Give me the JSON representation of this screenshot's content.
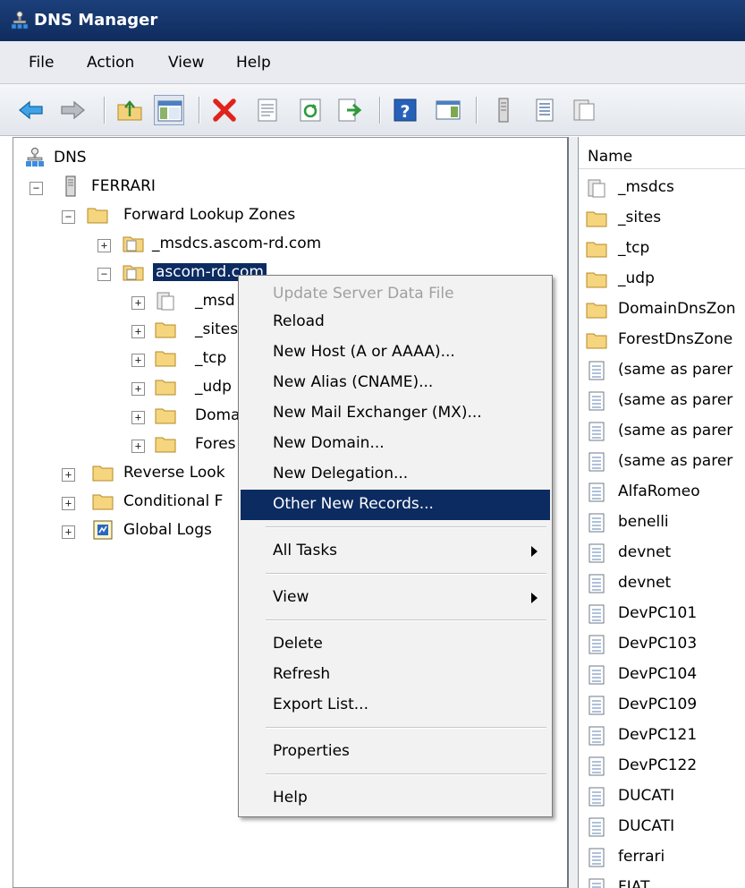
{
  "window": {
    "title": "DNS Manager"
  },
  "menubar": {
    "items": [
      "File",
      "Action",
      "View",
      "Help"
    ]
  },
  "toolbar": {
    "buttons": [
      "back-icon",
      "forward-icon",
      "up-folder-icon",
      "show-hide-tree-icon",
      "delete-icon",
      "properties-icon",
      "refresh-icon",
      "export-list-icon",
      "help-icon",
      "action-pane-icon",
      "server-icon",
      "list-view-icon",
      "zone-icon"
    ]
  },
  "tree": {
    "root": "DNS",
    "server": "FERRARI",
    "forward_zones": "Forward Lookup Zones",
    "zone_msdcs": "_msdcs.ascom-rd.com",
    "zone_selected": "ascom-rd.com",
    "child_msdcs": "_msd",
    "child_sites": "_sites",
    "child_tcp": "_tcp",
    "child_udp": "_udp",
    "child_domain": "Doma",
    "child_forest": "Fores",
    "reverse_zones": "Reverse Look",
    "conditional": "Conditional F",
    "global_logs": "Global Logs"
  },
  "list": {
    "header": "Name",
    "rows": [
      {
        "name": "_msdcs",
        "icon": "zone-icon"
      },
      {
        "name": "_sites",
        "icon": "folder-icon"
      },
      {
        "name": "_tcp",
        "icon": "folder-icon"
      },
      {
        "name": "_udp",
        "icon": "folder-icon"
      },
      {
        "name": "DomainDnsZon",
        "icon": "folder-icon"
      },
      {
        "name": "ForestDnsZone",
        "icon": "folder-icon"
      },
      {
        "name": "(same as parer",
        "icon": "record-icon"
      },
      {
        "name": "(same as parer",
        "icon": "record-icon"
      },
      {
        "name": "(same as parer",
        "icon": "record-icon"
      },
      {
        "name": "(same as parer",
        "icon": "record-icon"
      },
      {
        "name": "AlfaRomeo",
        "icon": "record-icon"
      },
      {
        "name": "benelli",
        "icon": "record-icon"
      },
      {
        "name": "devnet",
        "icon": "record-icon"
      },
      {
        "name": "devnet",
        "icon": "record-icon"
      },
      {
        "name": "DevPC101",
        "icon": "record-icon"
      },
      {
        "name": "DevPC103",
        "icon": "record-icon"
      },
      {
        "name": "DevPC104",
        "icon": "record-icon"
      },
      {
        "name": "DevPC109",
        "icon": "record-icon"
      },
      {
        "name": "DevPC121",
        "icon": "record-icon"
      },
      {
        "name": "DevPC122",
        "icon": "record-icon"
      },
      {
        "name": "DUCATI",
        "icon": "record-icon"
      },
      {
        "name": "DUCATI",
        "icon": "record-icon"
      },
      {
        "name": "ferrari",
        "icon": "record-icon"
      },
      {
        "name": "FIAT",
        "icon": "record-icon"
      }
    ]
  },
  "context_menu": {
    "update_server_data_file": "Update Server Data File",
    "reload": "Reload",
    "new_host": "New Host (A or AAAA)...",
    "new_alias": "New Alias (CNAME)...",
    "new_mail_exchanger": "New Mail Exchanger (MX)...",
    "new_domain": "New Domain...",
    "new_delegation": "New Delegation...",
    "other_new_records": "Other New Records...",
    "all_tasks": "All Tasks",
    "view": "View",
    "delete": "Delete",
    "refresh": "Refresh",
    "export_list": "Export List...",
    "properties": "Properties",
    "help": "Help"
  },
  "colors": {
    "selection": "#0b2b61",
    "titlebar": "#1c3f7a",
    "folder": "#f3d17a"
  }
}
